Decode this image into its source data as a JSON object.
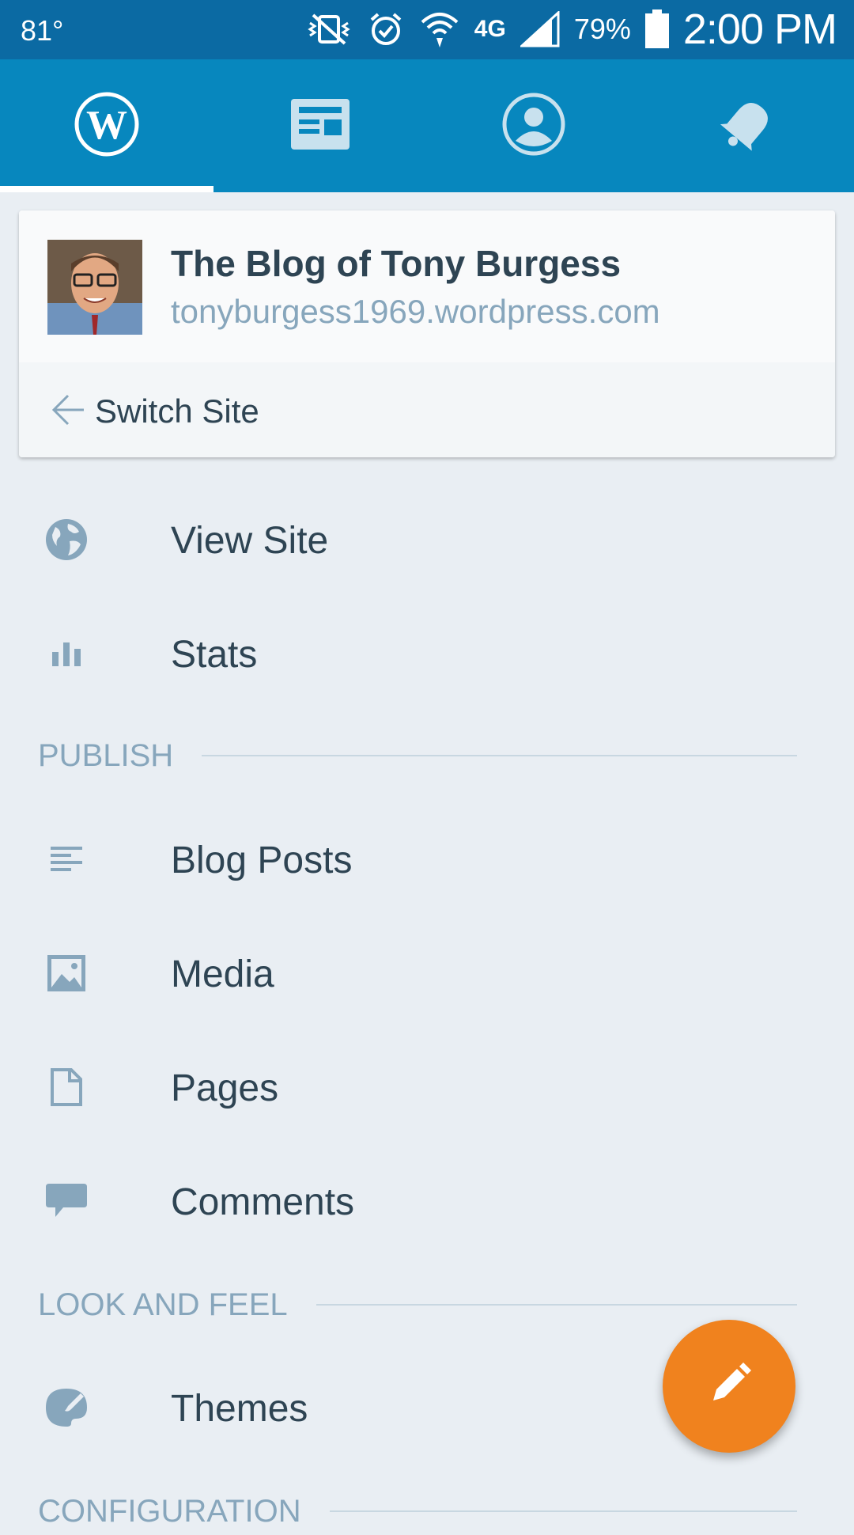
{
  "status_bar": {
    "temperature": "81°",
    "battery": "79%",
    "time": "2:00 PM",
    "network": "4G",
    "icons": [
      "vibrate-mute-icon",
      "alarm-icon",
      "wifi-icon",
      "lte-icon",
      "signal-icon",
      "battery-icon"
    ]
  },
  "tabs": [
    {
      "name": "my-sites",
      "icon": "wordpress-icon",
      "active": true
    },
    {
      "name": "reader",
      "icon": "reader-icon",
      "active": false
    },
    {
      "name": "me",
      "icon": "profile-icon",
      "active": false
    },
    {
      "name": "notifications",
      "icon": "bell-icon",
      "active": false
    }
  ],
  "site": {
    "title": "The Blog of Tony Burgess",
    "url": "tonyburgess1969.wordpress.com",
    "switch_label": "Switch Site"
  },
  "menu": {
    "view_site": "View Site",
    "stats": "Stats",
    "publish_header": "PUBLISH",
    "blog_posts": "Blog Posts",
    "media": "Media",
    "pages": "Pages",
    "comments": "Comments",
    "look_header": "LOOK AND FEEL",
    "themes": "Themes",
    "config_header": "CONFIGURATION"
  },
  "colors": {
    "status_bar": "#0b6aa3",
    "tab_bar": "#0787be",
    "fab": "#f0821e",
    "icon": "#87a6bc",
    "text": "#2e4453"
  }
}
